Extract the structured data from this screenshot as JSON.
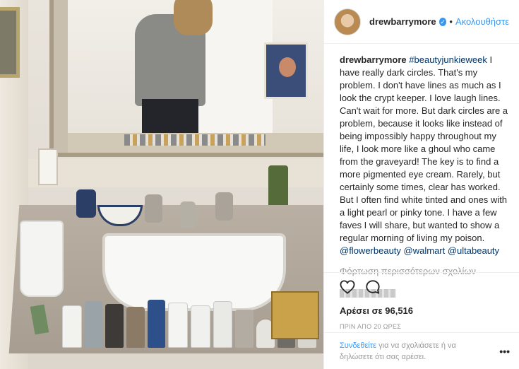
{
  "header": {
    "username": "drewbarrymore",
    "separator": "•",
    "follow_label": "Ακολουθήστε"
  },
  "caption": {
    "username": "drewbarrymore",
    "hashtag": "#beautyjunkieweek",
    "text": " I have really dark circles. That's my problem. I don't have lines as much as I look the crypt keeper. I love laugh lines. Can't wait for more. But dark circles are a problem, because it looks like instead of being impossibly happy throughout my life, I look more like a ghoul who came from the graveyard! The key is to find a more pigmented eye cream. Rarely, but certainly some times, clear has worked. But I often find white tinted and ones with a light pearl or pinky tone. I have a few faves I will share, but wanted to show a regular morning of living my poison. ",
    "mention1": "@flowerbeauty",
    "mention2": "@walmart",
    "mention3": "@ultabeauty"
  },
  "load_more_label": "Φόρτωση περισσότερων σχολίων",
  "likes_label": "Αρέσει σε 96,516",
  "time_label": "ΠΡΙΝ ΑΠΟ 20 ΩΡΕΣ",
  "login": {
    "link_label": "Συνδεθείτε",
    "text": " για να σχολιάσετε ή να δηλώσετε ότι σας αρέσει."
  },
  "more_label": "•••",
  "icons": {
    "like": "heart-icon",
    "comment": "comment-icon",
    "verified": "verified-badge-icon"
  },
  "colors": {
    "link_blue": "#3897f0",
    "mention_blue": "#003569",
    "muted_gray": "#999999"
  }
}
